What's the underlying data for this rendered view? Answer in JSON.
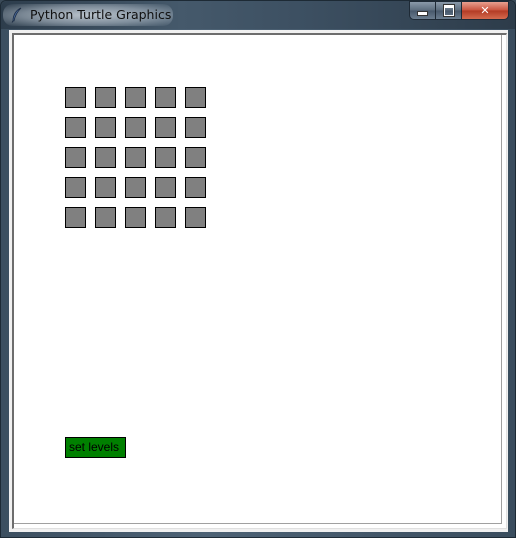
{
  "window": {
    "title": "Python Turtle Graphics",
    "icon": "feather-icon"
  },
  "title_buttons": {
    "minimize": "minimize-icon",
    "maximize": "maximize-icon",
    "close": "close-icon",
    "close_glyph": "✕"
  },
  "canvas": {
    "background": "#ffffff",
    "tile_grid": {
      "rows": 5,
      "columns": 5,
      "tile_color": "#808080",
      "outline_color": "#000000"
    },
    "button": {
      "label": "set levels",
      "color": "#008000"
    }
  }
}
